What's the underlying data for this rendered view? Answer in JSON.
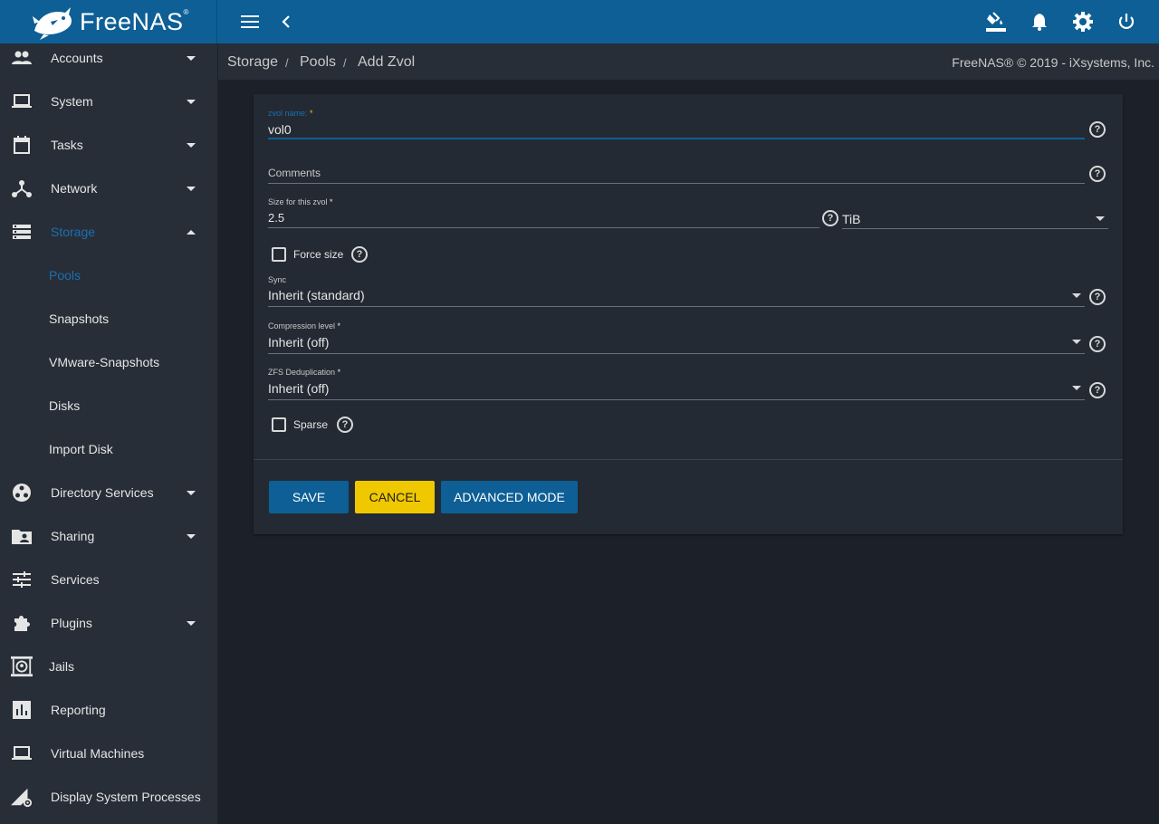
{
  "app": {
    "logo_text": "FreeNAS",
    "logo_mark": "®"
  },
  "sidebar": {
    "items": [
      {
        "label": "Accounts",
        "icon": "people-icon"
      },
      {
        "label": "System",
        "icon": "laptop-icon"
      },
      {
        "label": "Tasks",
        "icon": "calendar-icon"
      },
      {
        "label": "Network",
        "icon": "network-icon"
      },
      {
        "label": "Storage",
        "icon": "storage-icon"
      },
      {
        "label": "Directory Services",
        "icon": "directory-icon"
      },
      {
        "label": "Sharing",
        "icon": "folder-shared-icon"
      },
      {
        "label": "Services",
        "icon": "tune-icon"
      },
      {
        "label": "Plugins",
        "icon": "puzzle-icon"
      },
      {
        "label": "Jails",
        "icon": "jail-icon"
      },
      {
        "label": "Reporting",
        "icon": "chart-icon"
      },
      {
        "label": "Virtual Machines",
        "icon": "computer-icon"
      },
      {
        "label": "Display System Processes",
        "icon": "processes-icon"
      }
    ],
    "storage_sub": [
      "Pools",
      "Snapshots",
      "VMware-Snapshots",
      "Disks",
      "Import Disk"
    ],
    "active_item": "Storage",
    "active_sub": "Pools"
  },
  "breadcrumb": {
    "items": [
      "Storage",
      "Pools",
      "Add Zvol"
    ],
    "separator": "/"
  },
  "copyright": "FreeNAS® © 2019 - iXsystems, Inc.",
  "form": {
    "zvol_name": {
      "label": "zvol name",
      "required": "*",
      "value": "vol0"
    },
    "comments": {
      "placeholder": "Comments"
    },
    "size": {
      "label": "Size for this zvol",
      "required": "*",
      "value": "2.5",
      "unit": "TiB"
    },
    "force_size": {
      "label": "Force size",
      "checked": false
    },
    "sync": {
      "label": "Sync",
      "value": "Inherit (standard)"
    },
    "compression": {
      "label": "Compression level",
      "required": "*",
      "value": "Inherit (off)"
    },
    "dedup": {
      "label": "ZFS Deduplication",
      "required": "*",
      "value": "Inherit (off)"
    },
    "sparse": {
      "label": "Sparse",
      "checked": false
    }
  },
  "buttons": {
    "save": "SAVE",
    "cancel": "CANCEL",
    "advanced": "ADVANCED MODE"
  },
  "help_glyph": "?",
  "colors": {
    "topbar": "#0d5f96",
    "sidebar": "#272e37",
    "background": "#1c2129",
    "card": "#232a33",
    "accent": "#1d6fb0",
    "cancel": "#f0c800"
  }
}
